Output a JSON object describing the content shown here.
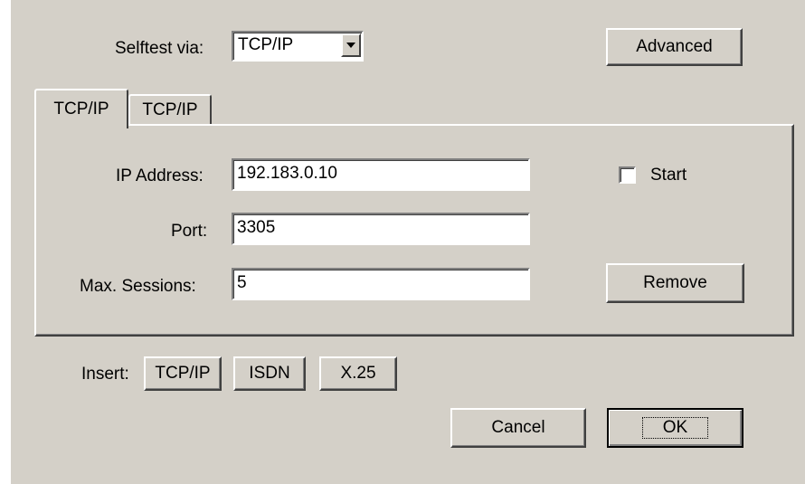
{
  "selftest": {
    "label": "Selftest via:",
    "value": "TCP/IP"
  },
  "buttons": {
    "advanced": "Advanced",
    "remove": "Remove",
    "cancel": "Cancel",
    "ok": "OK"
  },
  "tabs": [
    {
      "label": "TCP/IP",
      "active": true
    },
    {
      "label": "TCP/IP",
      "active": false
    }
  ],
  "form": {
    "ip_label": "IP Address:",
    "ip_value": "192.183.0.10",
    "port_label": "Port:",
    "port_value": "3305",
    "sessions_label": "Max. Sessions:",
    "sessions_value": "5",
    "start_label": "Start",
    "start_checked": false
  },
  "insert": {
    "label": "Insert:",
    "buttons": [
      "TCP/IP",
      "ISDN",
      "X.25"
    ]
  },
  "icons": {
    "dropdown": "triangle-down-icon"
  }
}
